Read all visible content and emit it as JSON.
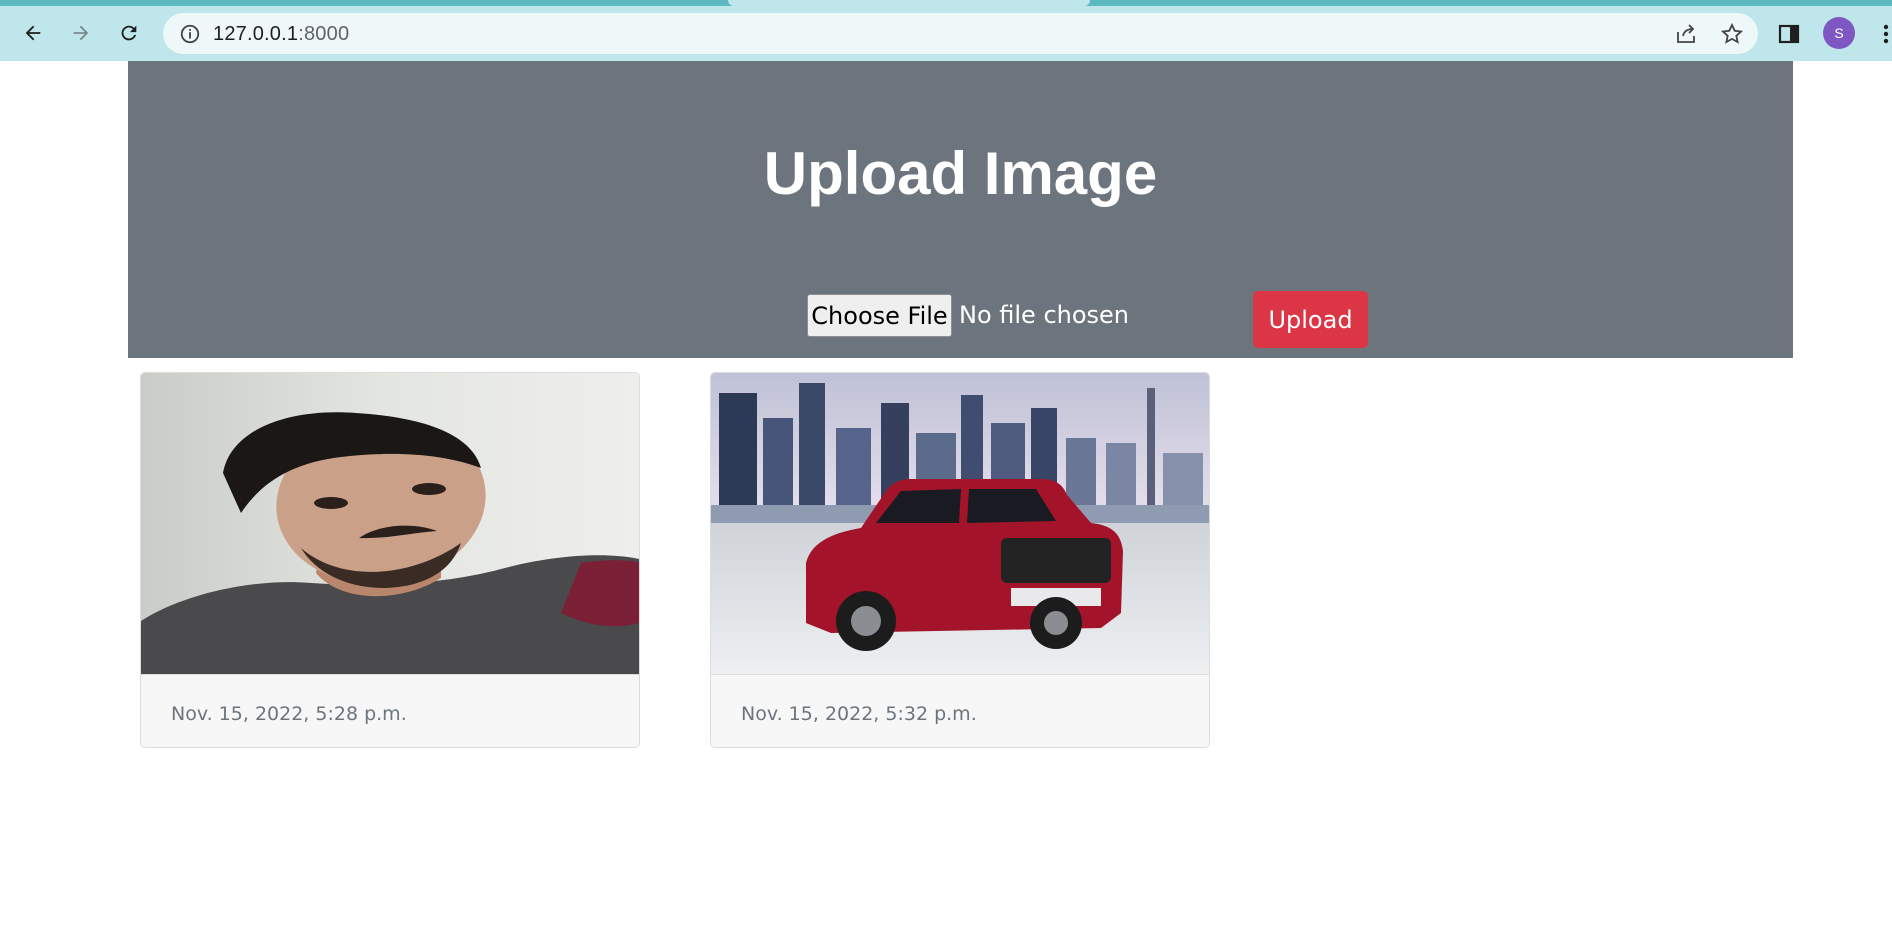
{
  "browser": {
    "url_host": "127.0.0.1",
    "url_port": ":8000",
    "avatar_letter": "S",
    "icons": [
      "back-arrow-icon",
      "forward-arrow-icon",
      "reload-icon",
      "site-info-icon",
      "share-icon",
      "bookmark-star-icon",
      "side-panel-icon",
      "kebab-menu-icon"
    ]
  },
  "hero": {
    "title": "Upload Image",
    "choose_file_label": "Choose File",
    "file_status": "No file chosen",
    "upload_label": "Upload"
  },
  "cards": [
    {
      "image": "portrait-photo",
      "timestamp": "Nov. 15, 2022, 5:28 p.m."
    },
    {
      "image": "red-suv-photo",
      "timestamp": "Nov. 15, 2022, 5:32 p.m."
    }
  ],
  "colors": {
    "hero_bg": "#6c757d",
    "upload_button": "#dc3545",
    "chrome_bg": "#bfe6ea"
  }
}
